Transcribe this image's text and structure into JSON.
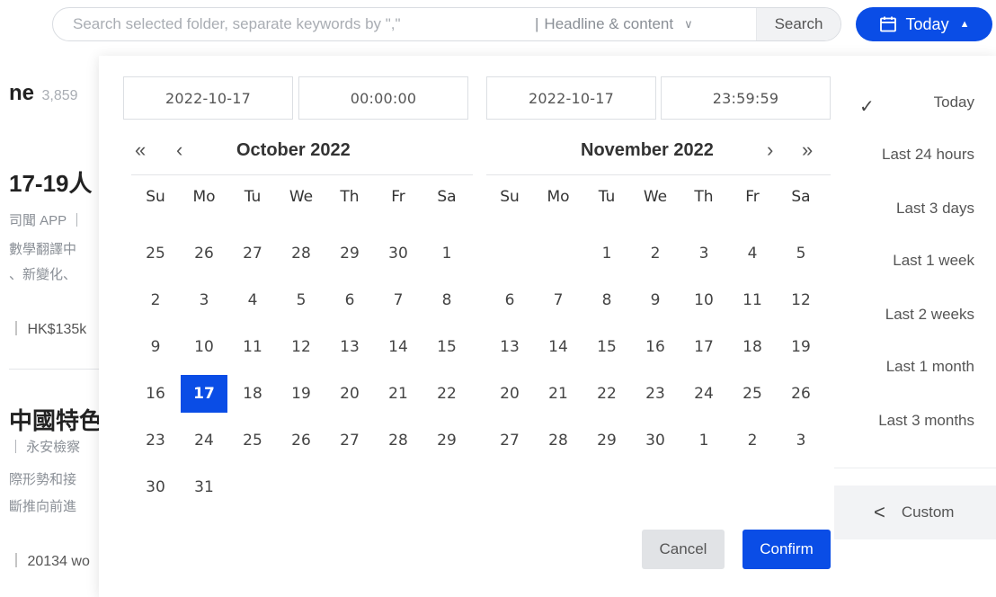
{
  "search": {
    "placeholder": "Search selected folder, separate keywords by \",\"",
    "separator": "|",
    "scope": "Headline & content",
    "button": "Search"
  },
  "date_range_button": {
    "label": "Today",
    "icon": "calendar-icon",
    "caret_icon": "caret-up-icon"
  },
  "background": {
    "count_prefix": "ne",
    "count": "3,859",
    "headline1": "17-19人",
    "line1": "司聞 APP ｜",
    "line2": "數學翻譯中",
    "line3": "、新變化、",
    "meta1": "｜ HK$135k",
    "headline2": "中國特色",
    "line4": "｜ 永安檢察",
    "line5": "際形勢和接",
    "line6": "斷推向前進",
    "meta2": "｜ 20134 wo"
  },
  "picker": {
    "start_date": "2022-10-17",
    "start_time": "00:00:00",
    "end_date": "2022-10-17",
    "end_time": "23:59:59",
    "nav": {
      "prev_year": "«",
      "prev_month": "‹",
      "next_month": "›",
      "next_year": "»"
    },
    "weekdays": [
      "Su",
      "Mo",
      "Tu",
      "We",
      "Th",
      "Fr",
      "Sa"
    ],
    "left_month": {
      "title": "October 2022",
      "weeks": [
        [
          "25",
          "26",
          "27",
          "28",
          "29",
          "30",
          "1"
        ],
        [
          "2",
          "3",
          "4",
          "5",
          "6",
          "7",
          "8"
        ],
        [
          "9",
          "10",
          "11",
          "12",
          "13",
          "14",
          "15"
        ],
        [
          "16",
          "17",
          "18",
          "19",
          "20",
          "21",
          "22"
        ],
        [
          "23",
          "24",
          "25",
          "26",
          "27",
          "28",
          "29"
        ],
        [
          "30",
          "31",
          "",
          "",
          "",
          "",
          ""
        ]
      ],
      "selected": "17"
    },
    "right_month": {
      "title": "November 2022",
      "weeks": [
        [
          "",
          "",
          "1",
          "2",
          "3",
          "4",
          "5"
        ],
        [
          "6",
          "7",
          "8",
          "9",
          "10",
          "11",
          "12"
        ],
        [
          "13",
          "14",
          "15",
          "16",
          "17",
          "18",
          "19"
        ],
        [
          "20",
          "21",
          "22",
          "23",
          "24",
          "25",
          "26"
        ],
        [
          "27",
          "28",
          "29",
          "30",
          "1",
          "2",
          "3"
        ]
      ]
    },
    "cancel": "Cancel",
    "confirm": "Confirm",
    "quick_ranges": [
      "Today",
      "Last 24 hours",
      "Last 3 days",
      "Last 1 week",
      "Last 2 weeks",
      "Last 1 month",
      "Last 3 months"
    ],
    "quick_selected": "Today",
    "check": "✓",
    "custom": {
      "icon": "chevron-left-icon",
      "label": "Custom"
    },
    "colors": {
      "accent": "#0a4de6"
    }
  }
}
